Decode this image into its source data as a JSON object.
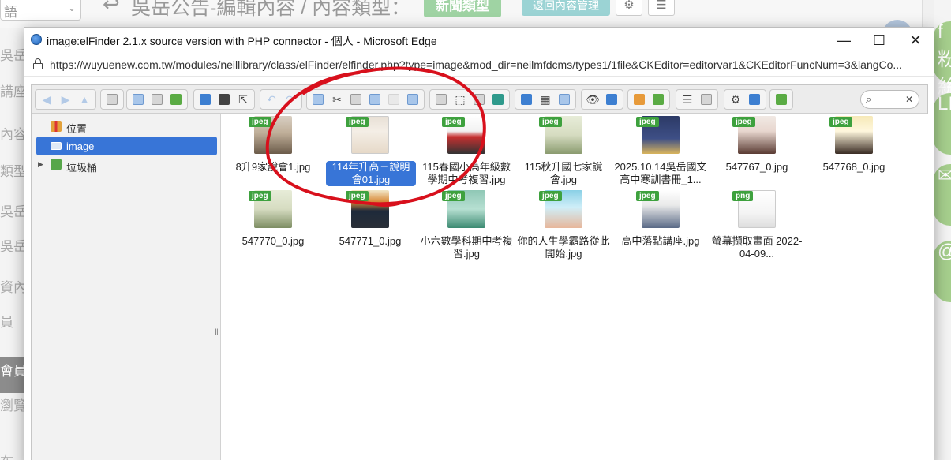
{
  "background": {
    "select_text": "語",
    "page_title": "吳岳公告-編輯內容 / 內容類型：",
    "type_button": "新聞類型",
    "back_button": "返回內容管理",
    "left_menu": [
      "吳岳",
      "講座",
      "內容",
      "類型",
      "吳岳",
      "吳岳",
      "資內",
      "員",
      "會員",
      "瀏覽",
      "布"
    ],
    "social_labels": [
      "f 粉絲",
      "LIN",
      "✉",
      "@"
    ]
  },
  "window": {
    "title": "image:elFinder 2.1.x source version with PHP connector - 個人 - Microsoft Edge",
    "url": "https://wuyuenew.com.tw/modules/neillibrary/class/elFinder/elfinder.php?type=image&mod_dir=neilmfdcms/types1/1file&CKEditor=editorvar1&CKEditorFuncNum=3&langCo...",
    "minimize": "—",
    "maximize": "☐",
    "close": "✕"
  },
  "navbar": {
    "items": [
      {
        "label": "位置",
        "icon": "places-icon"
      },
      {
        "label": "image",
        "icon": "drive-icon",
        "selected": true
      },
      {
        "label": "垃圾桶",
        "icon": "trash-icon"
      }
    ]
  },
  "files": [
    {
      "name": "8升9家說會1.jpg",
      "type": "jpeg"
    },
    {
      "name": "114年升高三說明會01.jpg",
      "type": "jpeg",
      "selected": true
    },
    {
      "name": "115春國小高年級數學期中考複習.jpg",
      "type": "jpeg"
    },
    {
      "name": "115秋升國七家說會.jpg",
      "type": "jpeg"
    },
    {
      "name": "2025.10.14吳岳國文高中寒訓書冊_1...",
      "type": "jpeg"
    },
    {
      "name": "547767_0.jpg",
      "type": "jpeg"
    },
    {
      "name": "547768_0.jpg",
      "type": "jpeg"
    },
    {
      "name": "547770_0.jpg",
      "type": "jpeg"
    },
    {
      "name": "547771_0.jpg",
      "type": "jpeg"
    },
    {
      "name": "小六數學科期中考複習.jpg",
      "type": "jpeg"
    },
    {
      "name": "你的人生學霸路從此開始.jpg",
      "type": "jpeg"
    },
    {
      "name": "高中落點講座.jpg",
      "type": "jpeg"
    },
    {
      "name": "螢幕擷取畫面 2022-04-09...",
      "type": "png"
    }
  ],
  "colors": {
    "selection": "#3875d7",
    "badge": "#3ea13e",
    "annotation": "#d8101c"
  }
}
